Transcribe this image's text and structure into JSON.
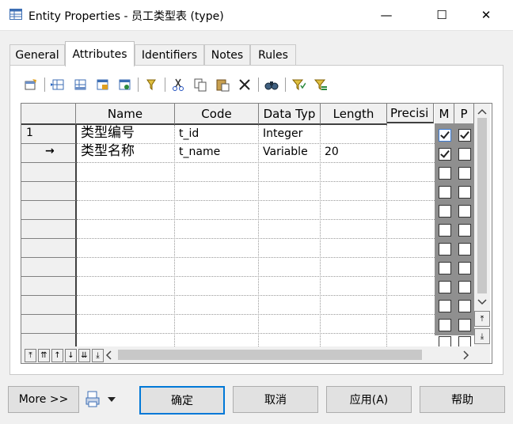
{
  "window": {
    "title": "Entity Properties - 员工类型表 (type)",
    "minimize_glyph": "—",
    "maximize_glyph": "☐",
    "close_glyph": "✕"
  },
  "tabs": [
    {
      "label": "General"
    },
    {
      "label": "Attributes",
      "active": true
    },
    {
      "label": "Identifiers"
    },
    {
      "label": "Notes"
    },
    {
      "label": "Rules"
    }
  ],
  "toolbar": {
    "icons": [
      "properties-icon",
      "insert-row-icon",
      "add-row-icon",
      "add-attributes-icon",
      "reuse-attributes-icon",
      "customize-columns-icon",
      "cut-icon",
      "copy-icon",
      "paste-icon",
      "delete-icon",
      "find-icon",
      "filter-icon",
      "clear-filter-icon"
    ]
  },
  "grid": {
    "columns": [
      "Name",
      "Code",
      "Data Typ",
      "Length",
      "Precisi",
      "M",
      "P"
    ],
    "rows": [
      {
        "marker": "1",
        "name": "类型编号",
        "code": "t_id",
        "data_type": "Integer",
        "length": "",
        "precision": "",
        "m": true,
        "p": true
      },
      {
        "marker": "→",
        "name": "类型名称",
        "code": "t_name",
        "data_type": "Variable",
        "length": "20",
        "precision": "",
        "m": true,
        "p": false
      }
    ],
    "nav_buttons": [
      "⤒",
      "⇈",
      "↑",
      "↓",
      "⇊",
      "⤓"
    ]
  },
  "buttons": {
    "more": "More >>",
    "ok": "确定",
    "cancel": "取消",
    "apply": "应用(A)",
    "help": "帮助"
  },
  "colors": {
    "accent": "#0078d7",
    "checkbox_column": "#8f8f8f"
  }
}
